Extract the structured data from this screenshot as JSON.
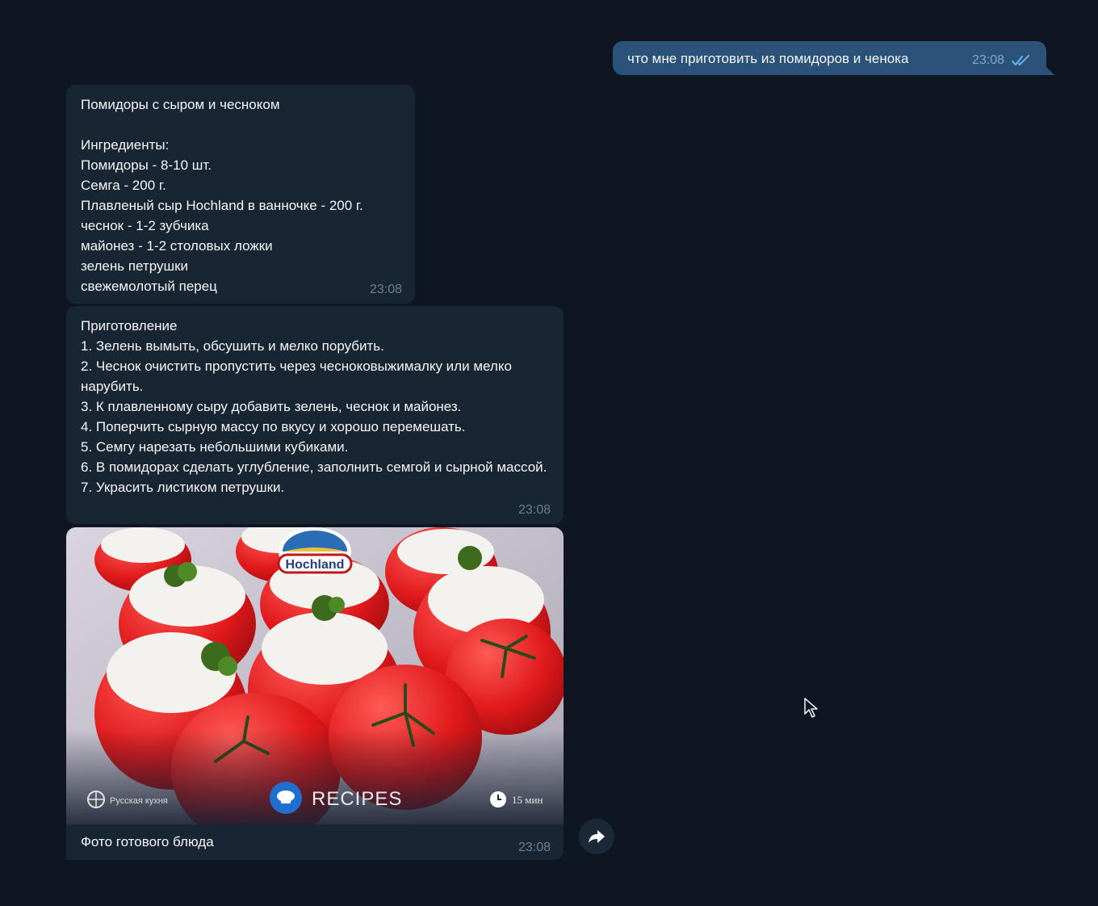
{
  "messages": {
    "outgoing": {
      "text": "что мне приготовить из помидоров и ченока",
      "time": "23:08"
    },
    "ingredients": {
      "text": "Помидоры с сыром и чесноком\n\nИнгредиенты:\nПомидоры - 8-10 шт.\nСемга - 200 г.\nПлавленый сыр Hochland в ванночке - 200 г.\nчеснок - 1-2 зубчика\nмайонез - 1-2 столовых ложки\nзелень петрушки\nсвежемолотый перец",
      "time": "23:08"
    },
    "preparation": {
      "text": "Приготовление\n1. Зелень вымыть, обсушить и мелко порубить.\n2. Чеснок очистить пропустить через чесноковыжималку или мелко нарубить.\n3. К плавленному сыру добавить зелень, чеснок и майонез.\n4. Поперчить сырную массу по вкусу и хорошо перемешать.\n5. Семгу нарезать небольшими кубиками.\n6. В помидорах сделать углубление, заполнить семгой и сырной массой.\n7. Украсить листиком петрушки.",
      "time": "23:08"
    },
    "photo": {
      "brand": "Hochland",
      "badge_label": "RECIPES",
      "cuisine_label": "Русская кухня",
      "duration_label": "15 мин",
      "caption": "Фото готового блюда",
      "time": "23:08"
    }
  },
  "colors": {
    "background": "#0e1621",
    "incoming_bubble": "#182533",
    "outgoing_bubble": "#2b5278",
    "read_check": "#6ab3f3"
  },
  "icons": {
    "read": "double-check-icon",
    "forward": "forward-arrow-icon",
    "cursor": "mouse-cursor-icon"
  }
}
